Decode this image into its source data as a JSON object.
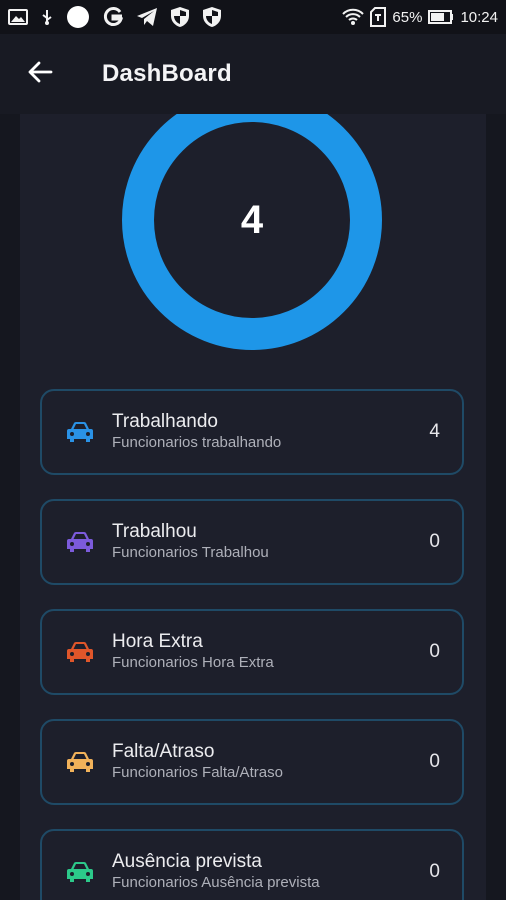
{
  "statusbar": {
    "battery": "65%",
    "time": "10:24",
    "icons": [
      "image-icon",
      "usb-icon",
      "circle-icon",
      "google-icon",
      "telegram-icon",
      "shield-icon",
      "shield-icon",
      "wifi-icon",
      "sd-card-icon",
      "battery-icon"
    ]
  },
  "header": {
    "title": "DashBoard",
    "back_icon": "arrow-left-icon"
  },
  "summary": {
    "total": "4",
    "ring_color": "#1e96e8"
  },
  "cards": [
    {
      "title": "Trabalhando",
      "subtitle": "Funcionarios trabalhando",
      "count": "4",
      "icon": "car-icon",
      "color": "#2a92e6"
    },
    {
      "title": "Trabalhou",
      "subtitle": "Funcionarios Trabalhou",
      "count": "0",
      "icon": "car-icon",
      "color": "#7c5bdc"
    },
    {
      "title": "Hora Extra",
      "subtitle": "Funcionarios Hora Extra",
      "count": "0",
      "icon": "car-icon",
      "color": "#e0562a"
    },
    {
      "title": "Falta/Atraso",
      "subtitle": "Funcionarios Falta/Atraso",
      "count": "0",
      "icon": "car-icon",
      "color": "#f2b25a"
    },
    {
      "title": "Ausência prevista",
      "subtitle": "Funcionarios Ausência prevista",
      "count": "0",
      "icon": "car-icon",
      "color": "#2cc98a"
    }
  ]
}
